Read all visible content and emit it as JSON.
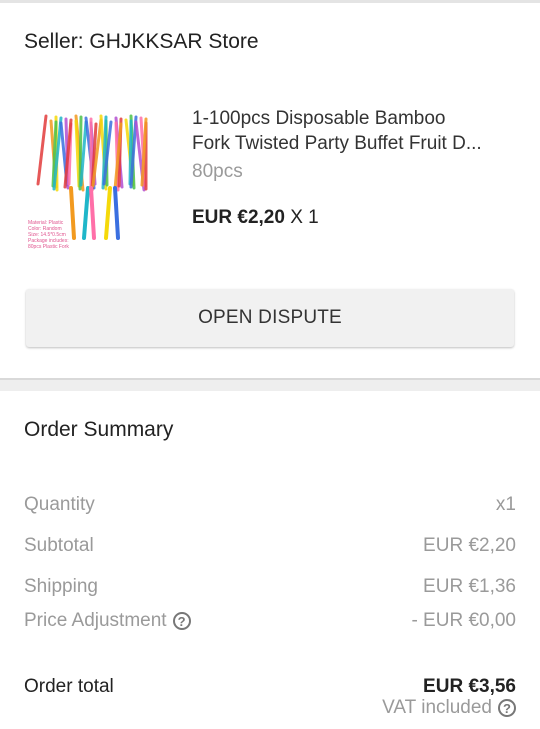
{
  "seller": {
    "label": "Seller: GHJKKSAR Store"
  },
  "product": {
    "title_line1": "1-100pcs Disposable Bamboo",
    "title_line2": "Fork Twisted Party Buffet Fruit D...",
    "variant": "80pcs",
    "price": "EUR €2,20",
    "quantity": "X 1",
    "image_caption": [
      "Material: Plastic",
      "Color: Random",
      "Size: 14.5*0.5cm",
      "Package includes:",
      "80pcs Plastic Fork"
    ]
  },
  "actions": {
    "open_dispute": "OPEN DISPUTE"
  },
  "summary": {
    "title": "Order Summary",
    "rows": [
      {
        "label": "Quantity",
        "value": "x1"
      },
      {
        "label": "Subtotal",
        "value": "EUR €2,20"
      },
      {
        "label": "Shipping",
        "value": "EUR €1,36"
      },
      {
        "label": "Price Adjustment",
        "value": "- EUR €0,00"
      }
    ],
    "total_label": "Order total",
    "total_value": "EUR €3,56",
    "vat_note": "VAT included"
  },
  "icons": {
    "help": "help-circle-icon"
  },
  "colors": {
    "muted": "#9a9a9a",
    "text": "#222222",
    "button_bg": "#f1f1f1"
  }
}
